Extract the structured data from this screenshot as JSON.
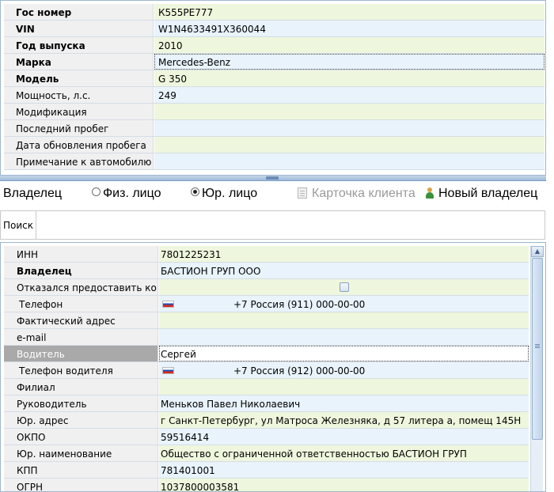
{
  "vehicle": {
    "rows": [
      {
        "label": "Гос номер",
        "value": "К555РЕ777",
        "bold": true,
        "color": "green"
      },
      {
        "label": "VIN",
        "value": "W1N4633491X360044",
        "bold": true,
        "color": "blue"
      },
      {
        "label": "Год выпуска",
        "value": "2010",
        "bold": true,
        "color": "green"
      },
      {
        "label": "Марка",
        "value": "Mercedes-Benz",
        "bold": true,
        "color": "blue"
      },
      {
        "label": "Модель",
        "value": "G 350",
        "bold": true,
        "color": "green"
      },
      {
        "label": "Мощность, л.с.",
        "value": "249",
        "bold": false,
        "color": "blue"
      },
      {
        "label": "Модификация",
        "value": "",
        "bold": false,
        "color": "green"
      },
      {
        "label": "Последний пробег",
        "value": "",
        "bold": false,
        "color": "blue"
      },
      {
        "label": "Дата обновления пробега",
        "value": "",
        "bold": false,
        "color": "green"
      },
      {
        "label": "Примечание к автомобилю",
        "value": "",
        "bold": false,
        "color": "blue"
      }
    ]
  },
  "owner_bar": {
    "title": "Владелец",
    "option_individual": "Физ. лицо",
    "option_legal": "Юр. лицо",
    "selected": "legal",
    "client_card_label": "Карточка клиента",
    "new_owner_label": "Новый владелец"
  },
  "search": {
    "label": "Поиск",
    "value": ""
  },
  "client": {
    "inn_label": "ИНН",
    "inn_value": "7801225231",
    "owner_label": "Владелец",
    "owner_value": "БАСТИОН ГРУП ООО",
    "refused_label": "Отказался предоставить ко...",
    "refused_checked": false,
    "phone_label": "Телефон",
    "phone_value": "+7 Россия (911) 000-00-00",
    "address_label": "Фактический адрес",
    "address_value": "",
    "email_label": "e-mail",
    "email_value": "",
    "driver_label": "Водитель",
    "driver_value": "Сергей",
    "driver_phone_label": "Телефон водителя",
    "driver_phone_value": "+7 Россия (912) 000-00-00",
    "branch_label": "Филиал",
    "branch_value": "",
    "director_label": "Руководитель",
    "director_value": "Меньков Павел Николаевич",
    "legal_address_label": "Юр. адрес",
    "legal_address_value": "г Санкт-Петербург, ул Матроса Железняка, д 57 литера а, помещ 145Н",
    "okpo_label": "ОКПО",
    "okpo_value": "59516414",
    "legal_name_label": "Юр. наименование",
    "legal_name_value": "Общество с ограниченной ответственностью БАСТИОН ГРУП",
    "kpp_label": "КПП",
    "kpp_value": "781401001",
    "ogrn_label": "ОГРН",
    "ogrn_value": "1037800003581"
  },
  "colors": {
    "row_green": "#eef7dd",
    "row_blue": "#e8f3fb",
    "label_bg": "#f0f0f0",
    "border": "#9fb6cf",
    "selected_label_bg": "#a9a9a9"
  }
}
